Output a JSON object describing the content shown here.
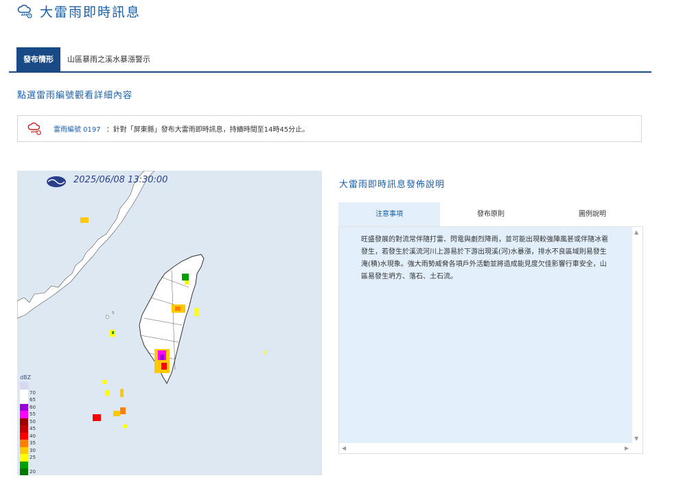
{
  "header": {
    "title": "大雷雨即時訊息"
  },
  "tabs": [
    {
      "label": "發布情形",
      "active": true
    },
    {
      "label": "山區暴雨之溪水暴漲警示",
      "active": false
    }
  ],
  "subtitle": "點選雷雨編號觀看詳細內容",
  "alert": {
    "id_label": "雷雨編號 0197",
    "text": "：針對「屏東縣」發布大雷雨即時訊息，持續時間至14時45分止。"
  },
  "radar": {
    "timestamp": "2025/06/08 13:30:00",
    "legend_unit": "dBZ",
    "legend": [
      {
        "label": "",
        "color": "#d8d8f0"
      },
      {
        "label": "70",
        "color": "#ffffff"
      },
      {
        "label": "65",
        "color": "#ffffff"
      },
      {
        "label": "60",
        "color": "#9a00d8"
      },
      {
        "label": "55",
        "color": "#ff00ff"
      },
      {
        "label": "50",
        "color": "#a00000"
      },
      {
        "label": "45",
        "color": "#c80000"
      },
      {
        "label": "40",
        "color": "#ff0000"
      },
      {
        "label": "35",
        "color": "#ff8000"
      },
      {
        "label": "30",
        "color": "#ffc800"
      },
      {
        "label": "25",
        "color": "#ffff00"
      },
      {
        "label": "",
        "color": "#00a000"
      },
      {
        "label": "20",
        "color": "#007800"
      }
    ]
  },
  "info": {
    "title": "大雷雨即時訊息發佈說明",
    "tabs": [
      {
        "label": "注意事項",
        "active": true
      },
      {
        "label": "發布原則",
        "active": false
      },
      {
        "label": "圖例說明",
        "active": false
      }
    ],
    "content": "旺盛發展的對流常伴隨打雷、閃電與劇烈降雨，並可能出現較強陣風甚或伴隨冰雹發生，若發生於溪流河川上游易於下游出現溪(河)水暴漲，排水不良區域則易發生淹(積)水現象。強大雨勢威脅各項戶外活動並將造成能見度欠佳影響行車安全，山區易發生坍方、落石、土石流。"
  },
  "colors": {
    "brand": "#1a5faa",
    "tab_active": "#1a4a85",
    "info_bg": "#e3f0fb",
    "radar_bg": "#dde8f2"
  }
}
